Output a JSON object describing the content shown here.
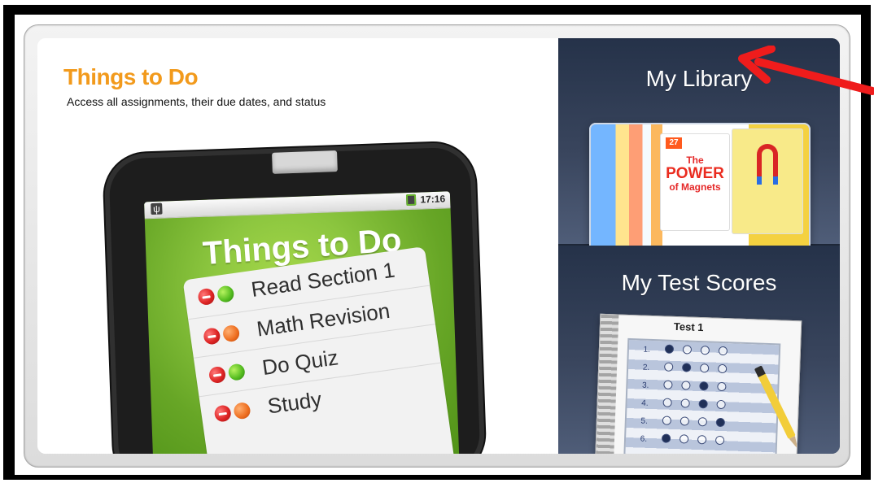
{
  "things_to_do": {
    "title": "Things to Do",
    "subtitle": "Access all assignments, their due dates, and status",
    "screen": {
      "time": "17:16",
      "title": "Things to Do",
      "items": [
        {
          "label": "Read Section 1",
          "status": "green"
        },
        {
          "label": "Math Revision",
          "status": "orange"
        },
        {
          "label": "Do Quiz",
          "status": "green"
        },
        {
          "label": "Study",
          "status": "orange"
        }
      ]
    }
  },
  "my_library": {
    "title": "My Library",
    "book": {
      "badge": "27",
      "line1": "The",
      "line2": "POWER",
      "line3": "of Magnets"
    }
  },
  "my_test_scores": {
    "title": "My Test Scores",
    "sheet_title": "Test 1",
    "rows": [
      {
        "number": "1.",
        "filled": [
          0
        ]
      },
      {
        "number": "2.",
        "filled": [
          1
        ]
      },
      {
        "number": "3.",
        "filled": [
          2
        ]
      },
      {
        "number": "4.",
        "filled": [
          2
        ]
      },
      {
        "number": "5.",
        "filled": [
          3
        ]
      },
      {
        "number": "6.",
        "filled": [
          0
        ]
      }
    ]
  },
  "annotation": {
    "arrow_color": "#ef1c1c"
  }
}
